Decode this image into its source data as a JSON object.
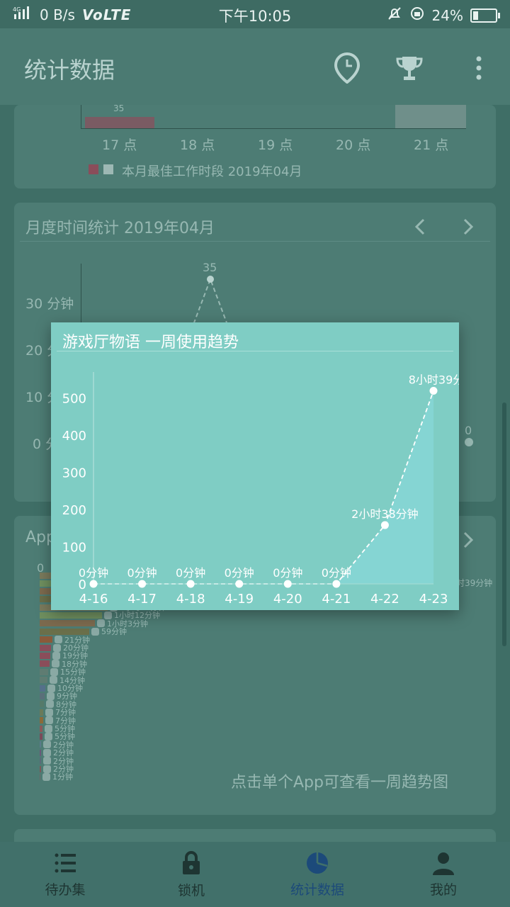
{
  "status_bar": {
    "network": "4G",
    "speed": "0 B/s",
    "volte": "VoLTE",
    "time": "下午10:05",
    "battery": "24%",
    "battery_level": 0.24
  },
  "app_bar": {
    "title": "统计数据"
  },
  "background": {
    "top_card": {
      "bar_label": "35",
      "hours": [
        "17 点",
        "18 点",
        "19 点",
        "20 点",
        "21 点"
      ],
      "legend": "本月最佳工作时段",
      "legend_month": "2019年04月"
    },
    "monthly_card": {
      "title": "月度时间统计 2019年04月",
      "peak_label": "35",
      "y_labels": [
        "30 分钟",
        "20 分",
        "10 分",
        "0 分"
      ],
      "right_value": "0"
    },
    "app_card": {
      "title": "App",
      "top_value": "0",
      "right_value": "时39分钟",
      "bar_labels": [
        "1小时33分钟",
        "1小时12分钟",
        "1小时3分钟",
        "59分钟",
        "21分钟",
        "20分钟",
        "19分钟",
        "18分钟",
        "15分钟",
        "14分钟",
        "10分钟",
        "9分钟",
        "8分钟",
        "7分钟",
        "7分钟",
        "5分钟",
        "5分钟",
        "2分钟",
        "2分钟",
        "2分钟",
        "2分钟",
        "1分钟"
      ],
      "hint": "点击单个App可查看一周趋势图"
    }
  },
  "dialog": {
    "title": "游戏厅物语 一周使用趋势",
    "chart_data": {
      "type": "area",
      "title": "游戏厅物语 一周使用趋势",
      "x": [
        "4-16",
        "4-17",
        "4-18",
        "4-19",
        "4-20",
        "4-21",
        "4-22",
        "4-23"
      ],
      "values": [
        0,
        0,
        0,
        0,
        0,
        0,
        158,
        519
      ],
      "point_labels": [
        "0分钟",
        "0分钟",
        "0分钟",
        "0分钟",
        "0分钟",
        "0分钟",
        "2小时38分钟",
        "8小时39分"
      ],
      "y_ticks": [
        "0",
        "100",
        "200",
        "300",
        "400",
        "500"
      ],
      "ylim": [
        0,
        520
      ],
      "grid": false
    }
  },
  "bottom_nav": [
    {
      "label": "待办集",
      "icon": "list-icon"
    },
    {
      "label": "锁机",
      "icon": "lock-icon"
    },
    {
      "label": "统计数据",
      "icon": "pie-chart-icon",
      "active": true
    },
    {
      "label": "我的",
      "icon": "person-icon"
    }
  ],
  "colors": {
    "dialog_bg": "#7fcdc4",
    "area_fill": "#86d6d6",
    "active_nav": "#1c4a7a"
  }
}
